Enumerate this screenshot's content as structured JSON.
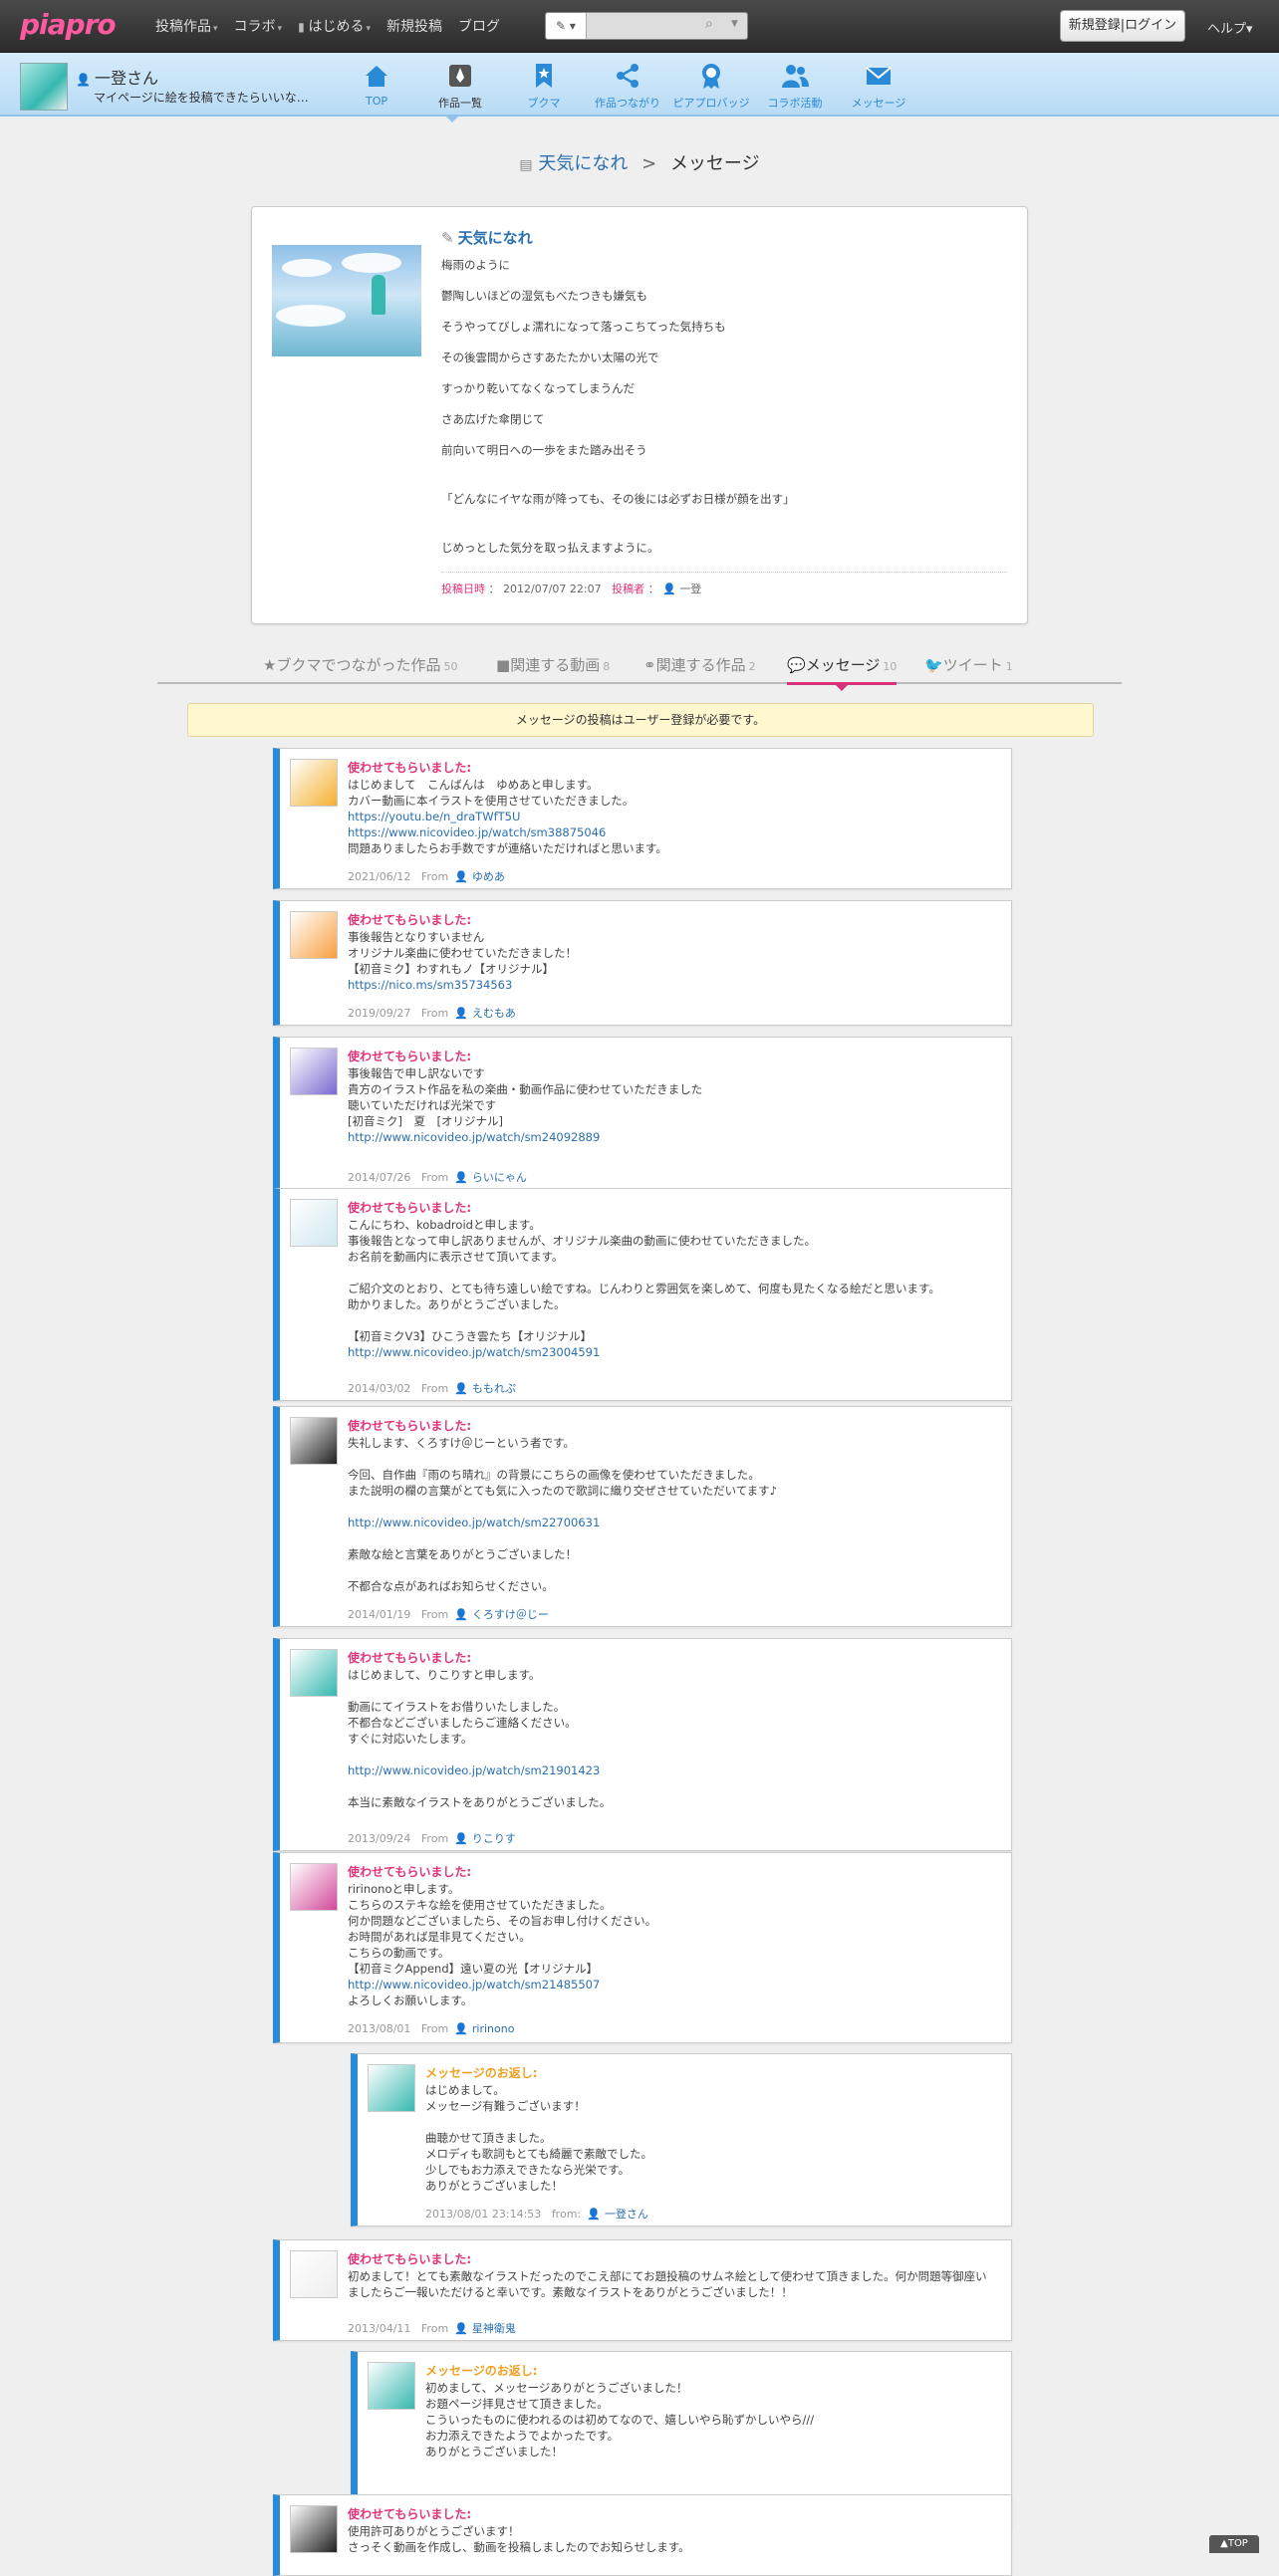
{
  "header": {
    "logo": "piapro",
    "nav": [
      {
        "label": "投稿作品",
        "caret": "▾"
      },
      {
        "label": "コラボ",
        "caret": "▾"
      },
      {
        "label": "はじめる",
        "caret": "▾"
      },
      {
        "label": "新規投稿",
        "caret": ""
      },
      {
        "label": "ブログ",
        "caret": ""
      }
    ],
    "search": {
      "type_label": "✎ ▾",
      "placeholder": ""
    },
    "login_label": "新規登録|ログイン",
    "help_label": "ヘルプ▾"
  },
  "userbar": {
    "name": "一登さん",
    "subtitle": "マイページに絵を投稿できたらいいな…",
    "tabs": [
      "TOP",
      "作品一覧",
      "ブクマ",
      "作品つながり",
      "ピアプロバッジ",
      "コラボ活動",
      "メッセージ"
    ]
  },
  "breadcrumb": {
    "work": "天気になれ",
    "separator": ">",
    "current": "メッセージ"
  },
  "work": {
    "title": "天気になれ",
    "lines": [
      "梅雨のように",
      "鬱陶しいほどの湿気もべたつきも嫌気も",
      "そうやってびしょ濡れになって落っこちてった気持ちも",
      "その後雲間からさすあたたかい太陽の光で",
      "すっかり乾いてなくなってしまうんだ",
      "さあ広げた傘閉じて",
      "前向いて明日への一歩をまた踏み出そう",
      "",
      "「どんなにイヤな雨が降っても、その後には必ずお日様が顔を出す」",
      "",
      "",
      "じめっとした気分を取っ払えますように。"
    ],
    "posted_label": "投稿日時",
    "posted_value": "2012/07/07 22:07",
    "author_label": "投稿者",
    "author": "一登"
  },
  "tabs": [
    {
      "label": "ブクマでつながった作品",
      "count": "50"
    },
    {
      "label": "関連する動画",
      "count": "8"
    },
    {
      "label": "関連する作品",
      "count": "2"
    },
    {
      "label": "メッセージ",
      "count": "10"
    },
    {
      "label": "ツイート",
      "count": "1"
    }
  ],
  "notice": "メッセージの投稿はユーザー登録が必要です。",
  "messages": [
    {
      "title": "使わせてもらいました:",
      "body": "はじめまして　こんばんは　ゆめあと申します。\nカバー動画に本イラストを使用させていただきました。",
      "links": [
        "https://youtu.be/n_draTWfT5U",
        "https://www.nicovideo.jp/watch/sm38875046"
      ],
      "after": "問題ありましたらお手数ですが連絡いただければと思います。",
      "date": "2021/06/12",
      "from": "From",
      "user": "ゆめあ"
    },
    {
      "title": "使わせてもらいました:",
      "body": "事後報告となりすいません\nオリジナル楽曲に使わせていただきました！\n【初音ミク】わすれもノ【オリジナル】",
      "links": [
        "https://nico.ms/sm35734563"
      ],
      "after": "",
      "date": "2019/09/27",
      "from": "From",
      "user": "えむもあ"
    },
    {
      "title": "使わせてもらいました:",
      "body": "事後報告で申し訳ないです\n貴方のイラスト作品を私の楽曲・動画作品に使わせていただきました\n聴いていただければ光栄です\n[初音ミク]　夏　[オリジナル]",
      "links": [
        "http://www.nicovideo.jp/watch/sm24092889"
      ],
      "after": "",
      "date": "2014/07/26",
      "from": "From",
      "user": "らいにゃん"
    },
    {
      "title": "使わせてもらいました:",
      "body": "こんにちわ、kobadroidと申します。\n事後報告となって申し訳ありませんが、オリジナル楽曲の動画に使わせていただきました。\nお名前を動画内に表示させて頂いてます。\n\nご紹介文のとおり、とても待ち遠しい絵ですね。じんわりと雰囲気を楽しめて、何度も見たくなる絵だと思います。\n助かりました。ありがとうございました。\n\n【初音ミクV3】ひこうき雲たち【オリジナル】",
      "links": [
        "http://www.nicovideo.jp/watch/sm23004591"
      ],
      "after": "",
      "date": "2014/03/02",
      "from": "From",
      "user": "ももれぷ"
    },
    {
      "title": "使わせてもらいました:",
      "body": "失礼します、くろすけ＠じーという者です。\n\n今回、自作曲『雨のち晴れ』の背景にこちらの画像を使わせていただきました。\nまた説明の欄の言葉がとても気に入ったので歌詞に織り交ぜさせていただいてます♪\n",
      "links": [
        "http://www.nicovideo.jp/watch/sm22700631"
      ],
      "after": "\n素敵な絵と言葉をありがとうございました！\n\n不都合な点があればお知らせください。",
      "date": "2014/01/19",
      "from": "From",
      "user": "くろすけ＠じー"
    },
    {
      "title": "使わせてもらいました:",
      "body": "はじめまして、りこりすと申します。\n\n動画にてイラストをお借りいたしました。\n不都合などございましたらご連絡ください。\nすぐに対応いたします。\n",
      "links": [
        "http://www.nicovideo.jp/watch/sm21901423"
      ],
      "after": "\n本当に素敵なイラストをありがとうございました。",
      "date": "2013/09/24",
      "from": "From",
      "user": "りこりす"
    },
    {
      "title": "使わせてもらいました:",
      "body": "ririnonoと申します。\nこちらのステキな絵を使用させていただきました。\n何か問題などございましたら、その旨お申し付けください。\nお時間があれば是非見てください。\nこちらの動画です。\n【初音ミクAppend】遠い夏の光【オリジナル】",
      "links": [
        "http://www.nicovideo.jp/watch/sm21485507"
      ],
      "after": "よろしくお願いします。",
      "date": "2013/08/01",
      "from": "From",
      "user": "ririnono"
    },
    {
      "title": "メッセージのお返し:",
      "reply": true,
      "body": "はじめまして。\nメッセージ有難うございます！\n\n曲聴かせて頂きました。\nメロディも歌詞もとても綺麗で素敵でした。\n少しでもお力添えできたなら光栄です。\nありがとうございました！",
      "links": [],
      "after": "",
      "date": "2013/08/01 23:14:53",
      "from": "from:",
      "user": "一登さん"
    },
    {
      "title": "使わせてもらいました:",
      "body": "初めまして！とても素敵なイラストだったのでこえ部にてお題投稿のサムネ絵として使わせて頂きました。何か問題等御座いましたらご一報いただけると幸いです。素敵なイラストをありがとうございました！！",
      "links": [],
      "after": "",
      "date": "2013/04/11",
      "from": "From",
      "user": "星神衛鬼"
    },
    {
      "title": "メッセージのお返し:",
      "reply": true,
      "body": "初めまして、メッセージありがとうございました！\nお題ページ拝見させて頂きました。\nこういったものに使われるのは初めてなので、嬉しいやら恥ずかしいやら///\nお力添えできたようでよかったです。\nありがとうございました！",
      "links": [],
      "after": "",
      "date": "2013/04/15 19:19:08",
      "from": "from:",
      "user": "一登さん"
    },
    {
      "title": "使わせてもらいました:",
      "body": "使用許可ありがとうございます！\nさっそく動画を作成し、動画を投稿しましたのでお知らせします。",
      "links": [],
      "after": "",
      "date": "",
      "from": "",
      "user": ""
    }
  ],
  "back_to_top": "▲TOP",
  "colors": {
    "accent": "#2a8ad6",
    "pink": "#e0357a",
    "reply": "#f0a020"
  }
}
